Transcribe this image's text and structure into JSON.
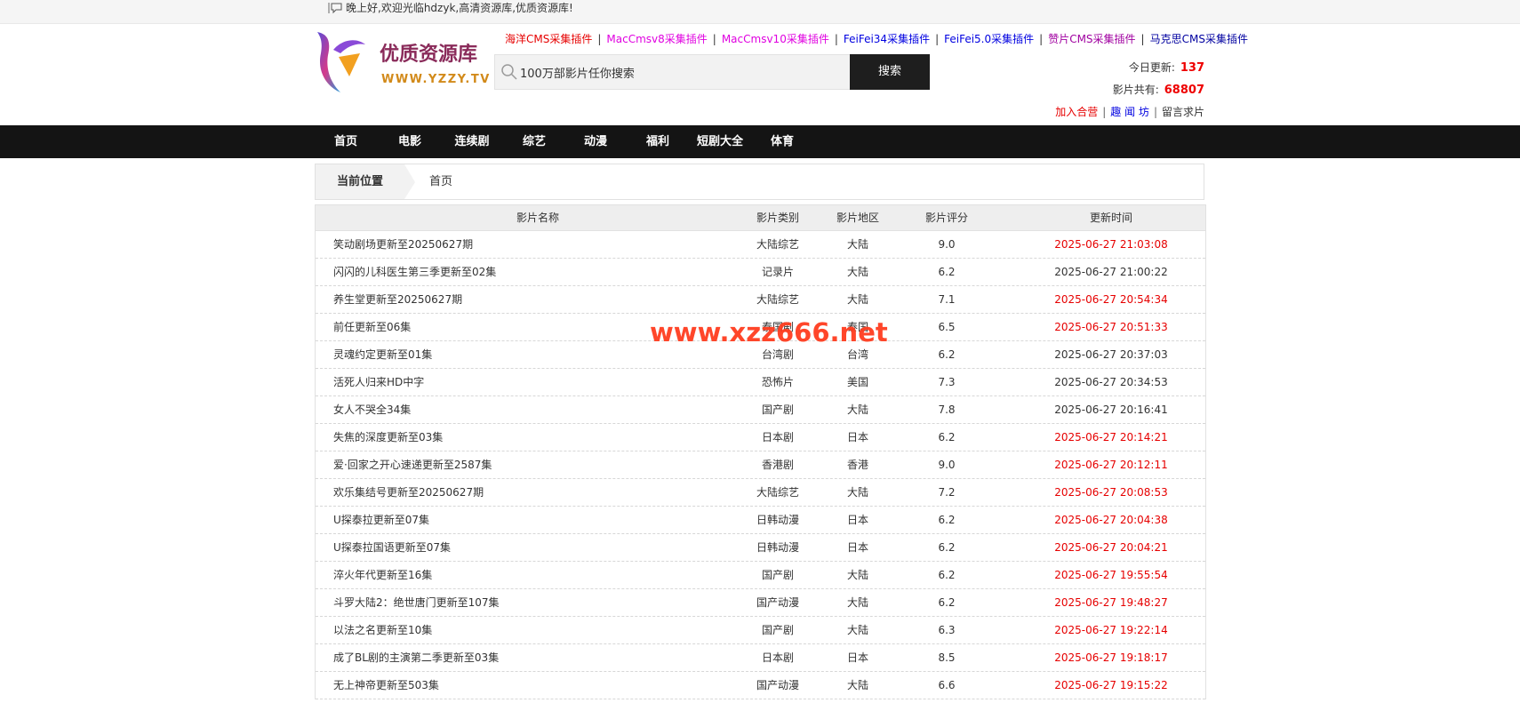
{
  "topbar": {
    "greeting": "晚上好,欢迎光临hdzyk,高清资源库,优质资源库!",
    "icon": "speech-bubble-icon"
  },
  "logo": {
    "cn": "优质资源库",
    "en": "WWW.YZZY.TV",
    "text": "优质资源库 WWW.YZZY.TV"
  },
  "plugins": [
    {
      "label": "海洋CMS采集插件",
      "color": "#e60000"
    },
    {
      "label": "MacCmsv8采集插件",
      "color": "#e000e0"
    },
    {
      "label": "MacCmsv10采集插件",
      "color": "#e000e0"
    },
    {
      "label": "FeiFei34采集插件",
      "color": "#0000e0"
    },
    {
      "label": "FeiFei5.0采集插件",
      "color": "#0000e0"
    },
    {
      "label": "赞片CMS采集插件",
      "color": "#a000a0"
    },
    {
      "label": "马克思CMS采集插件",
      "color": "#0000a0"
    }
  ],
  "search": {
    "placeholder": "100万部影片任你搜索",
    "value": "100万部影片任你搜索",
    "button": "搜索"
  },
  "stats": {
    "today_label": "今日更新:",
    "today_value": "137",
    "total_label": "影片共有:",
    "total_value": "68807",
    "join": "加入合营",
    "fun": "趣 闻 坊",
    "request": "留言求片"
  },
  "nav": [
    "首页",
    "电影",
    "连续剧",
    "综艺",
    "动漫",
    "福利",
    "短剧大全",
    "体育"
  ],
  "breadcrumb": {
    "label": "当前位置",
    "current": "首页"
  },
  "table": {
    "headers": {
      "name": "影片名称",
      "type": "影片类别",
      "area": "影片地区",
      "score": "影片评分",
      "time": "更新时间"
    },
    "rows": [
      {
        "name": "笑动剧场更新至20250627期",
        "type": "大陆综艺",
        "area": "大陆",
        "score": "9.0",
        "time": "2025-06-27 21:03:08",
        "hl": true
      },
      {
        "name": "闪闪的儿科医生第三季更新至02集",
        "type": "记录片",
        "area": "大陆",
        "score": "6.2",
        "time": "2025-06-27 21:00:22",
        "hl": false
      },
      {
        "name": "养生堂更新至20250627期",
        "type": "大陆综艺",
        "area": "大陆",
        "score": "7.1",
        "time": "2025-06-27 20:54:34",
        "hl": true
      },
      {
        "name": "前任更新至06集",
        "type": "泰国剧",
        "area": "泰国",
        "score": "6.5",
        "time": "2025-06-27 20:51:33",
        "hl": true
      },
      {
        "name": "灵魂约定更新至01集",
        "type": "台湾剧",
        "area": "台湾",
        "score": "6.2",
        "time": "2025-06-27 20:37:03",
        "hl": false
      },
      {
        "name": "活死人归来HD中字",
        "type": "恐怖片",
        "area": "美国",
        "score": "7.3",
        "time": "2025-06-27 20:34:53",
        "hl": false
      },
      {
        "name": "女人不哭全34集",
        "type": "国产剧",
        "area": "大陆",
        "score": "7.8",
        "time": "2025-06-27 20:16:41",
        "hl": false
      },
      {
        "name": "失焦的深度更新至03集",
        "type": "日本剧",
        "area": "日本",
        "score": "6.2",
        "time": "2025-06-27 20:14:21",
        "hl": true
      },
      {
        "name": "爱·回家之开心速递更新至2587集",
        "type": "香港剧",
        "area": "香港",
        "score": "9.0",
        "time": "2025-06-27 20:12:11",
        "hl": true
      },
      {
        "name": "欢乐集结号更新至20250627期",
        "type": "大陆综艺",
        "area": "大陆",
        "score": "7.2",
        "time": "2025-06-27 20:08:53",
        "hl": true
      },
      {
        "name": "U探泰拉更新至07集",
        "type": "日韩动漫",
        "area": "日本",
        "score": "6.2",
        "time": "2025-06-27 20:04:38",
        "hl": true
      },
      {
        "name": "U探泰拉国语更新至07集",
        "type": "日韩动漫",
        "area": "日本",
        "score": "6.2",
        "time": "2025-06-27 20:04:21",
        "hl": true
      },
      {
        "name": "淬火年代更新至16集",
        "type": "国产剧",
        "area": "大陆",
        "score": "6.2",
        "time": "2025-06-27 19:55:54",
        "hl": true
      },
      {
        "name": "斗罗大陆2：绝世唐门更新至107集",
        "type": "国产动漫",
        "area": "大陆",
        "score": "6.2",
        "time": "2025-06-27 19:48:27",
        "hl": true
      },
      {
        "name": "以法之名更新至10集",
        "type": "国产剧",
        "area": "大陆",
        "score": "6.3",
        "time": "2025-06-27 19:22:14",
        "hl": true
      },
      {
        "name": "成了BL剧的主演第二季更新至03集",
        "type": "日本剧",
        "area": "日本",
        "score": "8.5",
        "time": "2025-06-27 19:18:17",
        "hl": true
      },
      {
        "name": "无上神帝更新至503集",
        "type": "国产动漫",
        "area": "大陆",
        "score": "6.6",
        "time": "2025-06-27 19:15:22",
        "hl": true
      }
    ]
  },
  "watermark": "www.xzz666.net"
}
